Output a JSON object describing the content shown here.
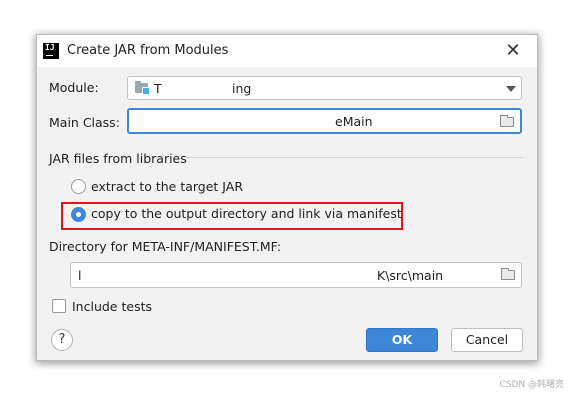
{
  "dialog": {
    "title": "Create JAR from Modules",
    "app_icon_text": "IJ",
    "close_glyph": "✕"
  },
  "module": {
    "label": "Module:",
    "value_part1": "T",
    "value_part2": "ing"
  },
  "main_class": {
    "label": "Main Class:",
    "value": "eMain"
  },
  "libraries": {
    "group_label": "JAR files from libraries",
    "options": [
      {
        "label": "extract to the target JAR",
        "checked": false
      },
      {
        "label": "copy to the output directory and link via manifest",
        "checked": true
      }
    ]
  },
  "manifest_dir": {
    "label": "Directory for META-INF/MANIFEST.MF:",
    "value_start": "l",
    "value_end": "K\\src\\main"
  },
  "include_tests": {
    "label": "Include tests",
    "checked": false
  },
  "buttons": {
    "help": "?",
    "ok": "OK",
    "cancel": "Cancel"
  },
  "watermark": "CSDN @韩曙亮",
  "colors": {
    "accent": "#3d87d7",
    "highlight": "#e0161c"
  }
}
